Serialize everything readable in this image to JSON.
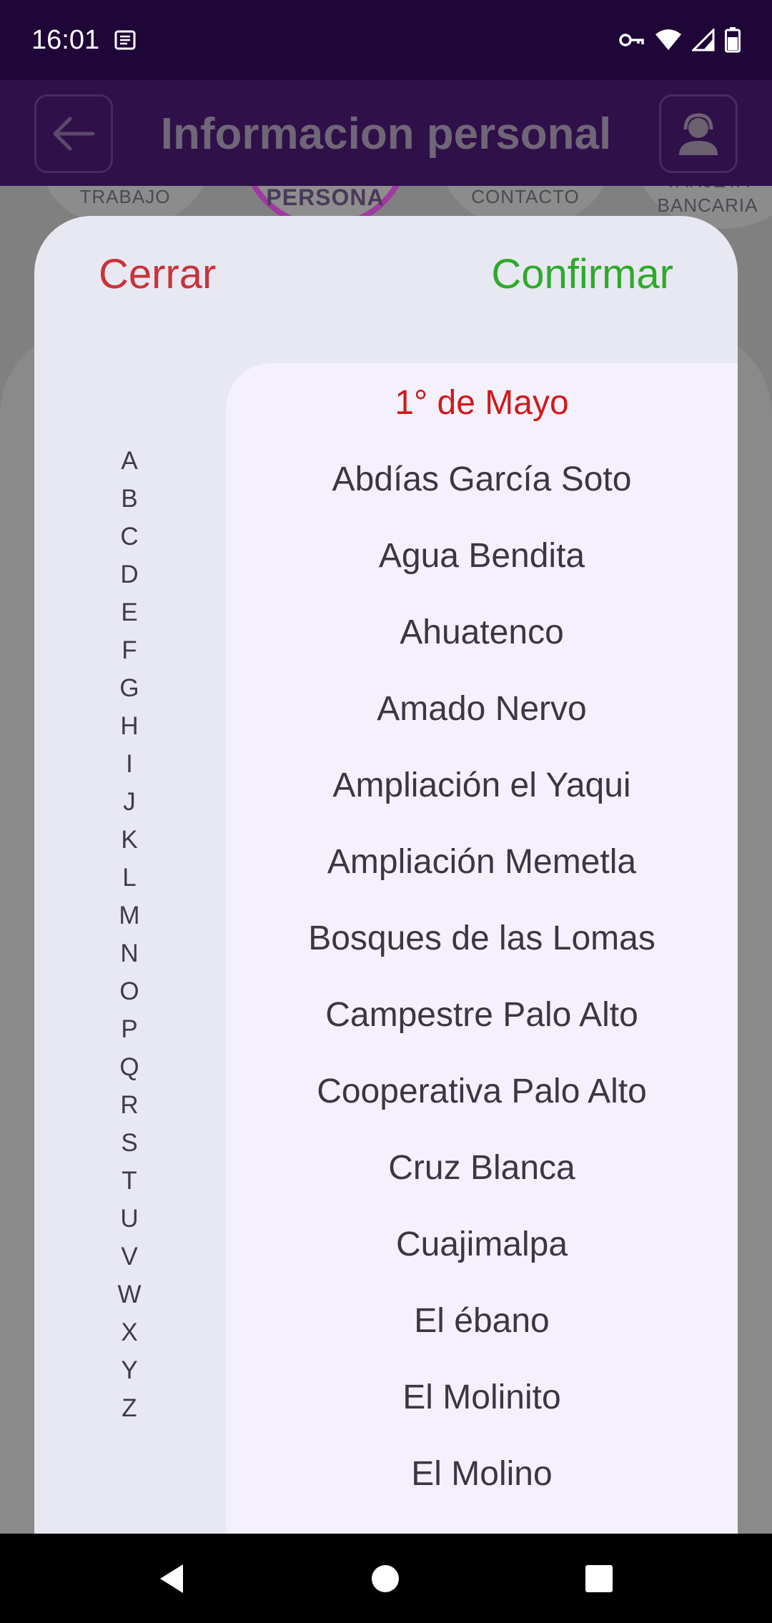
{
  "status_bar": {
    "time": "16:01",
    "icons": [
      "notification-icon",
      "vpn-key-icon",
      "wifi-icon",
      "cell-signal-icon",
      "battery-icon"
    ]
  },
  "app_bar": {
    "title": "Informacion personal",
    "back_icon": "arrow-left-icon",
    "agent_icon": "support-agent-icon"
  },
  "steps": {
    "trabajo": "TRABAJO",
    "persona": "PERSONA",
    "contacto": "CONTACTO",
    "tarjeta": "TARJETA",
    "bancaria": "BANCARIA"
  },
  "sheet": {
    "close_label": "Cerrar",
    "confirm_label": "Confirmar",
    "close_color": "#c8333a",
    "confirm_color": "#2eaa2a",
    "selected_color": "#d01a1a"
  },
  "alphabet": [
    "A",
    "B",
    "C",
    "D",
    "E",
    "F",
    "G",
    "H",
    "I",
    "J",
    "K",
    "L",
    "M",
    "N",
    "O",
    "P",
    "Q",
    "R",
    "S",
    "T",
    "U",
    "V",
    "W",
    "X",
    "Y",
    "Z"
  ],
  "items": [
    {
      "label": "1° de Mayo",
      "selected": true
    },
    {
      "label": "Abdías García Soto",
      "selected": false
    },
    {
      "label": "Agua Bendita",
      "selected": false
    },
    {
      "label": "Ahuatenco",
      "selected": false
    },
    {
      "label": "Amado Nervo",
      "selected": false
    },
    {
      "label": "Ampliación el Yaqui",
      "selected": false
    },
    {
      "label": "Ampliación Memetla",
      "selected": false
    },
    {
      "label": "Bosques de las Lomas",
      "selected": false
    },
    {
      "label": "Campestre Palo Alto",
      "selected": false
    },
    {
      "label": "Cooperativa Palo Alto",
      "selected": false
    },
    {
      "label": "Cruz Blanca",
      "selected": false
    },
    {
      "label": "Cuajimalpa",
      "selected": false
    },
    {
      "label": "El ébano",
      "selected": false
    },
    {
      "label": "El Molinito",
      "selected": false
    },
    {
      "label": "El Molino",
      "selected": false
    }
  ],
  "nav_bar": {
    "back_icon": "nav-back-icon",
    "home_icon": "nav-home-icon",
    "recents_icon": "nav-recents-icon"
  }
}
